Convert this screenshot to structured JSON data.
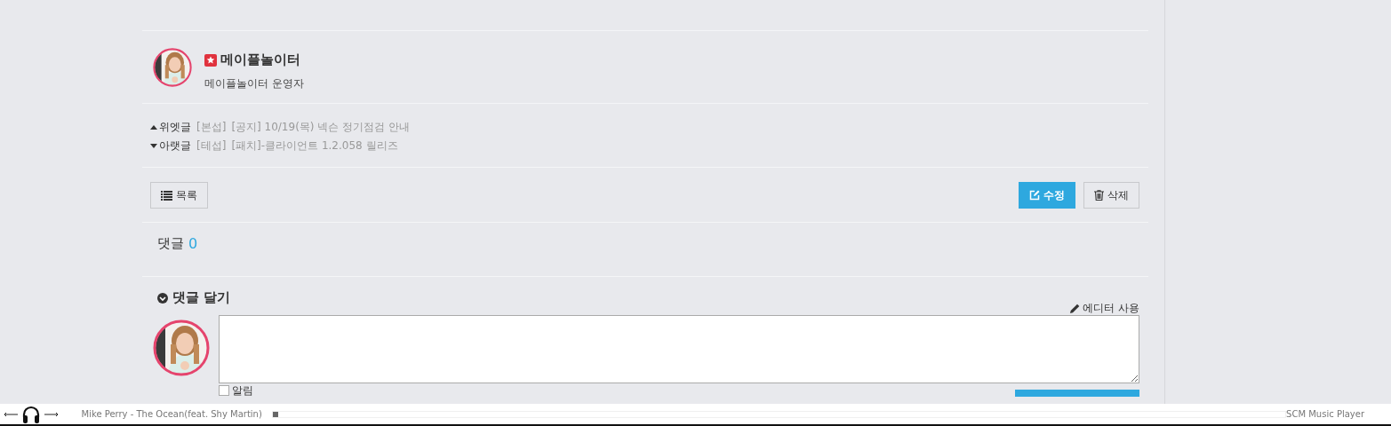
{
  "author": {
    "name": "메이플놀이터",
    "subtitle": "메이플놀이터 운영자"
  },
  "nav": [
    {
      "kind": "prev",
      "label": "위엣글",
      "category": "[본섭]",
      "title": "[공지] 10/19(목) 넥슨 정기점검 안내"
    },
    {
      "kind": "next",
      "label": "아랫글",
      "category": "[테섭]",
      "title": "[패치]-클라이언트 1.2.058 릴리즈"
    }
  ],
  "list_button": "목록",
  "actions": [
    {
      "kind": "edit",
      "label": "수정",
      "primary": true
    },
    {
      "kind": "delete",
      "label": "삭제",
      "primary": false
    }
  ],
  "comments": {
    "label": "댓글",
    "count": "0"
  },
  "comment_form": {
    "title": "댓글 달기",
    "editor_link": "에디터 사용",
    "notify": {
      "label": "알림",
      "checked": false
    }
  },
  "player": {
    "track": "Mike Perry - The Ocean(feat. Shy Martin)",
    "level": 0,
    "name": "SCM Music Player"
  }
}
